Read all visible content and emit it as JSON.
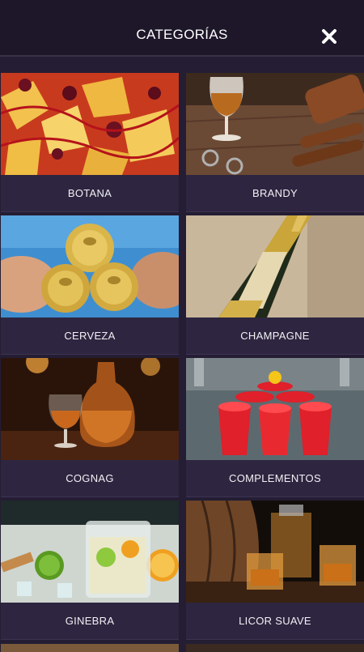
{
  "header": {
    "title": "CATEGORÍAS",
    "close_icon": "close-icon"
  },
  "categories": [
    {
      "label": "BOTANA",
      "image": "chips-with-sauce-photo"
    },
    {
      "label": "BRANDY",
      "image": "brandy-glass-and-cigars-photo"
    },
    {
      "label": "CERVEZA",
      "image": "beer-cans-in-hands-photo"
    },
    {
      "label": "CHAMPAGNE",
      "image": "champagne-bottle-photo"
    },
    {
      "label": "COGNAG",
      "image": "cognac-glass-and-decanter-photo"
    },
    {
      "label": "COMPLEMENTOS",
      "image": "red-cups-beer-pong-photo"
    },
    {
      "label": "GINEBRA",
      "image": "gin-tonic-cocktail-photo"
    },
    {
      "label": "LICOR SUAVE",
      "image": "whisky-glasses-and-barrel-photo"
    }
  ],
  "colors": {
    "background": "#241d33",
    "header": "#1d1729",
    "card": "#2e2640",
    "text": "#ffffff"
  }
}
